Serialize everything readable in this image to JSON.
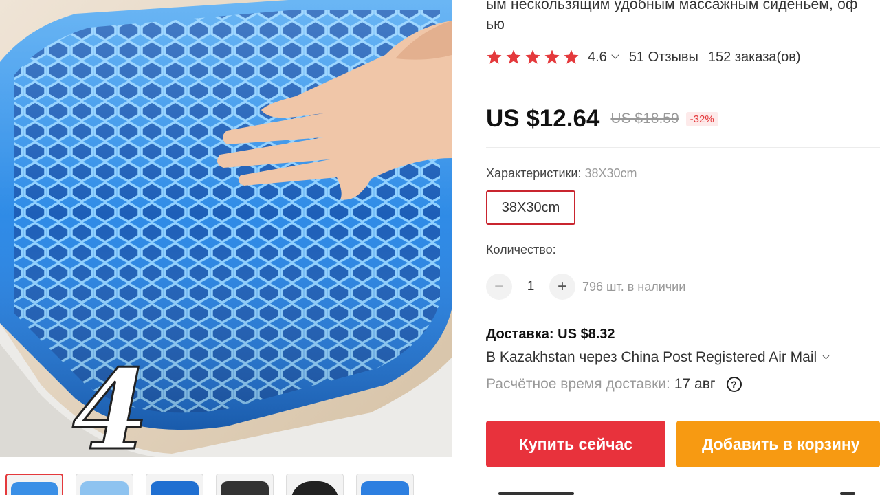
{
  "product": {
    "title_line1": "ым нескользящим удобным массажным сиденьем, оф",
    "title_line2": "ью",
    "rating": "4.6",
    "reviews": "51 Отзывы",
    "orders": "152 заказа(ов)",
    "stars_count": 5,
    "star_color": "#e4393c"
  },
  "price": {
    "current": "US $12.64",
    "original": "US $18.59",
    "discount": "-32%"
  },
  "specs": {
    "label": "Характеристики:",
    "selected": "38X30cm",
    "options": [
      "38X30cm"
    ]
  },
  "quantity": {
    "label": "Количество:",
    "minus": "−",
    "plus": "+",
    "value": "1",
    "stock": "796 шт. в наличии"
  },
  "shipping": {
    "title": "Доставка: US $8.32",
    "method": "В Kazakhstan через China Post Registered Air Mail",
    "eta_label": "Расчётное время доставки:",
    "eta_date": "17 авг",
    "help_glyph": "?"
  },
  "actions": {
    "buy_now": "Купить сейчас",
    "add_to_cart": "Добавить в корзину"
  },
  "gallery": {
    "overlay_number": "4",
    "thumbnail_colors": [
      "#3a8fe6",
      "#8ec3f0",
      "#1f6fd1",
      "#333333",
      "#222222",
      "#2d7fe0"
    ]
  },
  "colors": {
    "accent_red": "#e8323c",
    "accent_orange": "#f79a12"
  }
}
